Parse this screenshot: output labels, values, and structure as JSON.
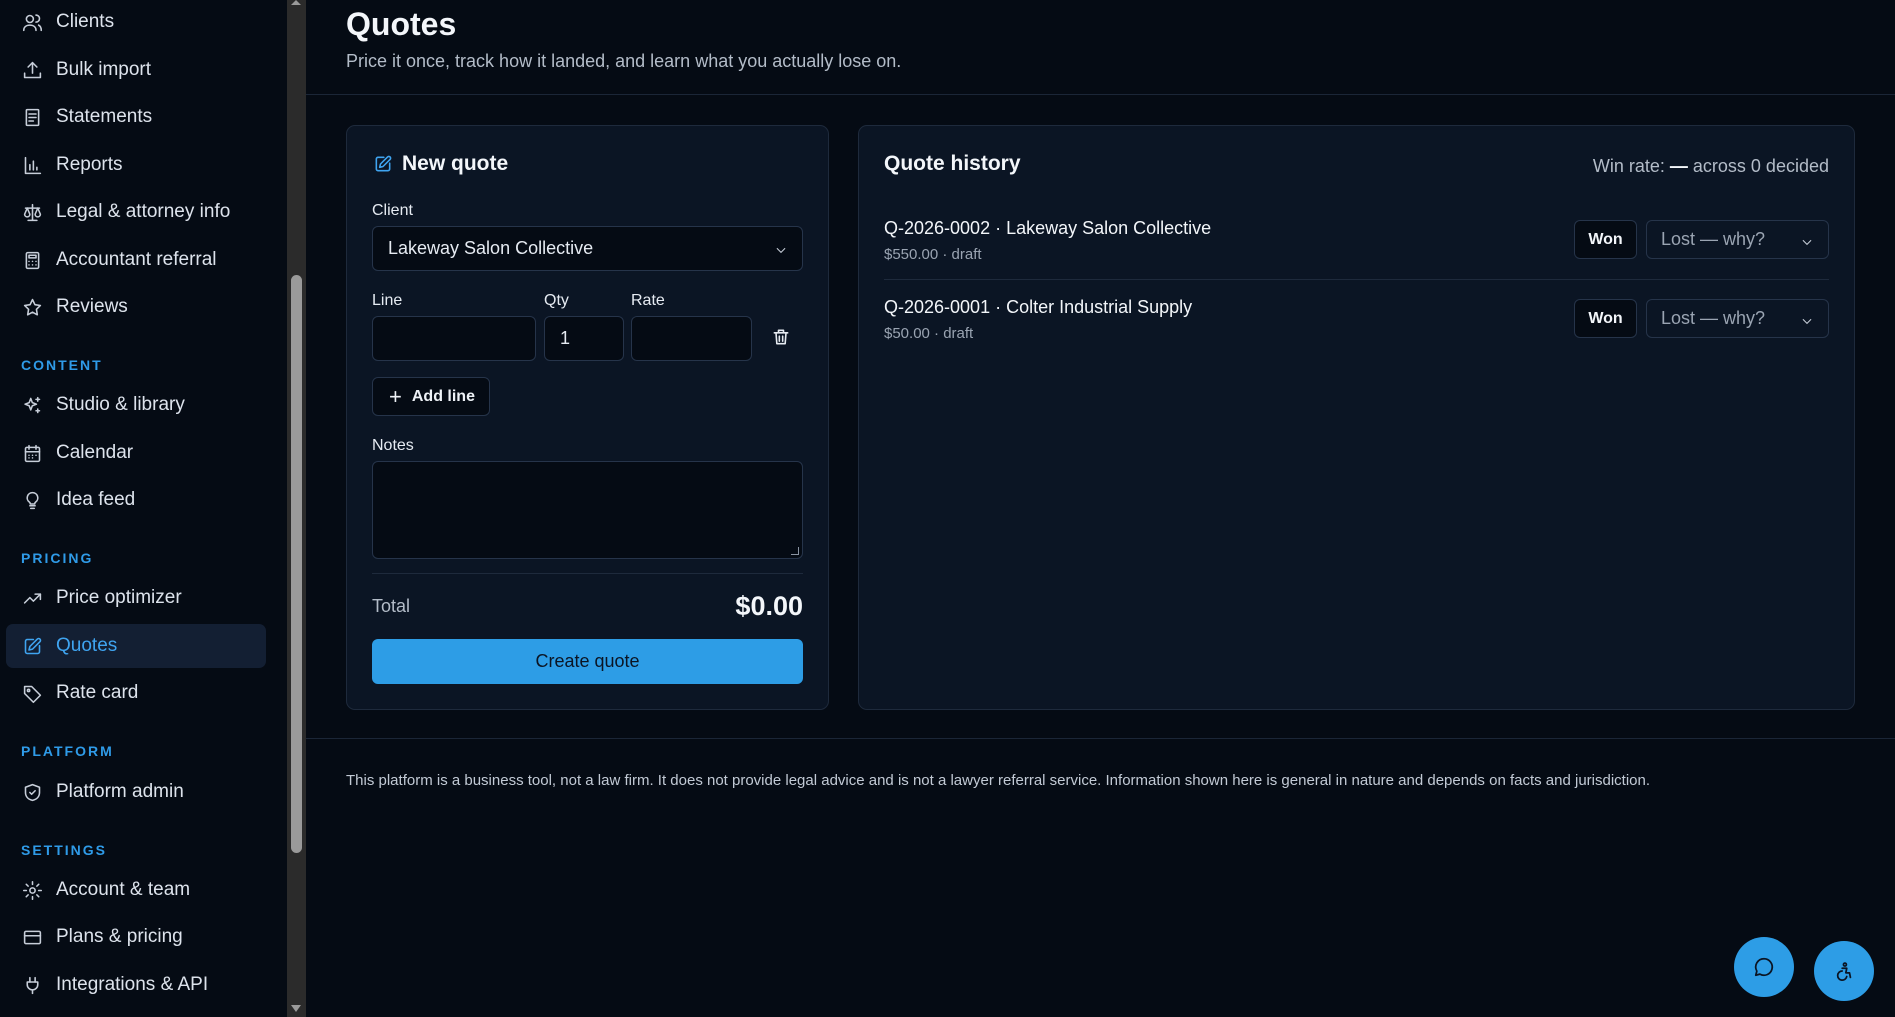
{
  "sidebar": {
    "items_top": [
      {
        "label": "Clients",
        "icon": "users-icon"
      },
      {
        "label": "Bulk import",
        "icon": "upload-icon"
      },
      {
        "label": "Statements",
        "icon": "document-icon"
      },
      {
        "label": "Reports",
        "icon": "bar-chart-icon"
      },
      {
        "label": "Legal & attorney info",
        "icon": "scale-icon"
      },
      {
        "label": "Accountant referral",
        "icon": "calculator-icon"
      },
      {
        "label": "Reviews",
        "icon": "star-icon"
      }
    ],
    "content_label": "CONTENT",
    "content_items": [
      {
        "label": "Studio & library",
        "icon": "sparkle-icon"
      },
      {
        "label": "Calendar",
        "icon": "calendar-icon"
      },
      {
        "label": "Idea feed",
        "icon": "lightbulb-icon"
      }
    ],
    "pricing_label": "PRICING",
    "pricing_items": [
      {
        "label": "Price optimizer",
        "icon": "trend-icon"
      },
      {
        "label": "Quotes",
        "icon": "edit-icon"
      },
      {
        "label": "Rate card",
        "icon": "tag-icon"
      }
    ],
    "platform_label": "PLATFORM",
    "platform_items": [
      {
        "label": "Platform admin",
        "icon": "shield-icon"
      }
    ],
    "settings_label": "SETTINGS",
    "settings_items": [
      {
        "label": "Account & team",
        "icon": "gear-icon"
      },
      {
        "label": "Plans & pricing",
        "icon": "card-icon"
      },
      {
        "label": "Integrations & API",
        "icon": "plug-icon"
      }
    ]
  },
  "page": {
    "title": "Quotes",
    "subtitle": "Price it once, track how it landed, and learn what you actually lose on."
  },
  "new_quote": {
    "title": "New quote",
    "client_label": "Client",
    "client_value": "Lakeway Salon Collective",
    "line_label": "Line",
    "qty_label": "Qty",
    "rate_label": "Rate",
    "line_value": "",
    "qty_value": "1",
    "rate_value": "",
    "add_line": "Add line",
    "notes_label": "Notes",
    "total_label": "Total",
    "total_value": "$0.00",
    "create_button": "Create quote"
  },
  "history": {
    "title": "Quote history",
    "winrate_prefix": "Win rate:",
    "winrate_value": "—",
    "winrate_suffix": "across 0 decided",
    "quotes": [
      {
        "title": "Q-2026-0002 · Lakeway Salon Collective",
        "meta": "$550.00 · draft",
        "won": "Won",
        "lost": "Lost — why?"
      },
      {
        "title": "Q-2026-0001 · Colter Industrial Supply",
        "meta": "$50.00 · draft",
        "won": "Won",
        "lost": "Lost — why?"
      }
    ]
  },
  "footer": {
    "disclaimer": "This platform is a business tool, not a law firm. It does not provide legal advice and is not a lawyer referral service. Information shown here is general in nature and depends on facts and jurisdiction."
  },
  "colors": {
    "accent": "#2d9de6",
    "background": "#050b14",
    "card": "#0b1524"
  }
}
